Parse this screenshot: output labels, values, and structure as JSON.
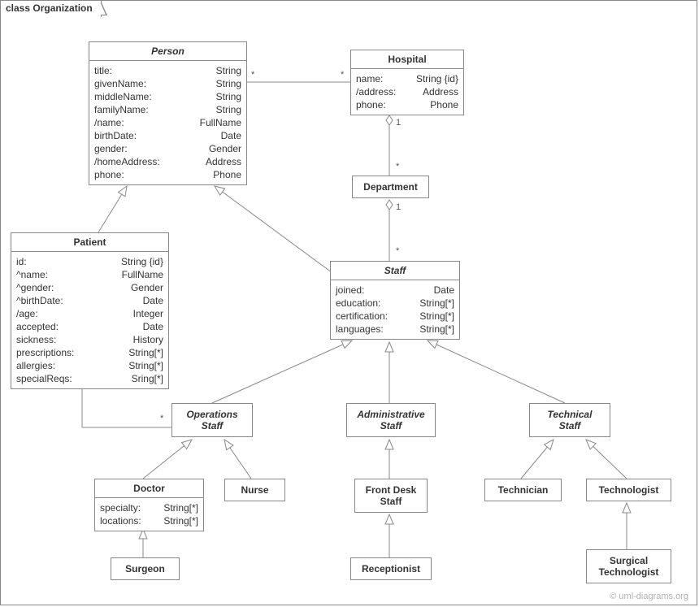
{
  "frame_title": "class Organization",
  "copyright": "© uml-diagrams.org",
  "classes": {
    "person": {
      "name": "Person",
      "attrs": [
        {
          "n": "title:",
          "t": "String"
        },
        {
          "n": "givenName:",
          "t": "String"
        },
        {
          "n": "middleName:",
          "t": "String"
        },
        {
          "n": "familyName:",
          "t": "String"
        },
        {
          "n": "/name:",
          "t": "FullName"
        },
        {
          "n": "birthDate:",
          "t": "Date"
        },
        {
          "n": "gender:",
          "t": "Gender"
        },
        {
          "n": "/homeAddress:",
          "t": "Address"
        },
        {
          "n": "phone:",
          "t": "Phone"
        }
      ]
    },
    "hospital": {
      "name": "Hospital",
      "attrs": [
        {
          "n": "name:",
          "t": "String {id}"
        },
        {
          "n": "/address:",
          "t": "Address"
        },
        {
          "n": "phone:",
          "t": "Phone"
        }
      ]
    },
    "department": {
      "name": "Department"
    },
    "patient": {
      "name": "Patient",
      "attrs": [
        {
          "n": "id:",
          "t": "String {id}"
        },
        {
          "n": "^name:",
          "t": "FullName"
        },
        {
          "n": "^gender:",
          "t": "Gender"
        },
        {
          "n": "^birthDate:",
          "t": "Date"
        },
        {
          "n": "/age:",
          "t": "Integer"
        },
        {
          "n": "accepted:",
          "t": "Date"
        },
        {
          "n": "sickness:",
          "t": "History"
        },
        {
          "n": "prescriptions:",
          "t": "String[*]"
        },
        {
          "n": "allergies:",
          "t": "String[*]"
        },
        {
          "n": "specialReqs:",
          "t": "Sring[*]"
        }
      ]
    },
    "staff": {
      "name": "Staff",
      "attrs": [
        {
          "n": "joined:",
          "t": "Date"
        },
        {
          "n": "education:",
          "t": "String[*]"
        },
        {
          "n": "certification:",
          "t": "String[*]"
        },
        {
          "n": "languages:",
          "t": "String[*]"
        }
      ]
    },
    "opstaff": {
      "name": "Operations",
      "name2": "Staff"
    },
    "admstaff": {
      "name": "Administrative",
      "name2": "Staff"
    },
    "techstaff": {
      "name": "Technical",
      "name2": "Staff"
    },
    "doctor": {
      "name": "Doctor",
      "attrs": [
        {
          "n": "specialty:",
          "t": "String[*]"
        },
        {
          "n": "locations:",
          "t": "String[*]"
        }
      ]
    },
    "nurse": {
      "name": "Nurse"
    },
    "frontdesk": {
      "name": "Front Desk",
      "name2": "Staff"
    },
    "technician": {
      "name": "Technician"
    },
    "technologist": {
      "name": "Technologist"
    },
    "surgeon": {
      "name": "Surgeon"
    },
    "receptionist": {
      "name": "Receptionist"
    },
    "surgtech": {
      "name": "Surgical",
      "name2": "Technologist"
    }
  },
  "mult": {
    "ph_star_l": "*",
    "ph_star_r": "*",
    "hd_one": "1",
    "hd_star": "*",
    "ds_one": "1",
    "ds_star": "*",
    "po_star_b": "*",
    "po_star_t": "*"
  }
}
